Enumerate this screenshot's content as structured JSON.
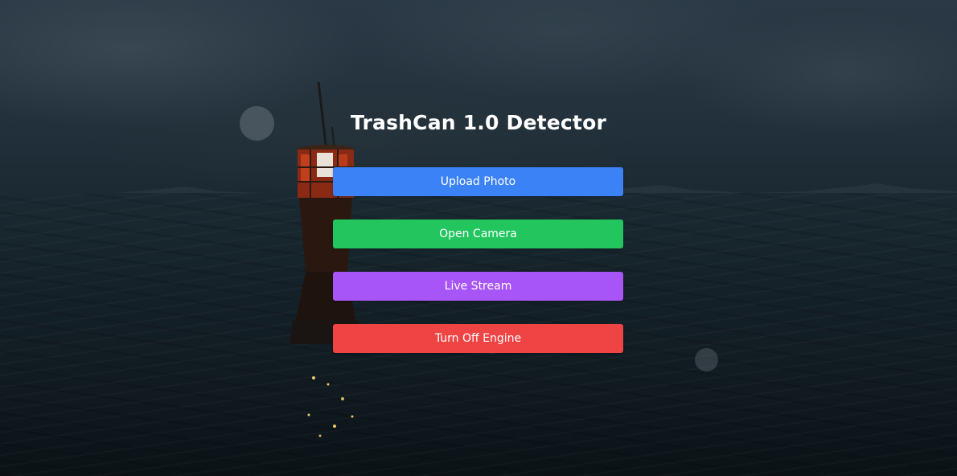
{
  "app": {
    "title": "TrashCan 1.0 Detector"
  },
  "actions": {
    "upload_photo": {
      "label": "Upload Photo",
      "color": "#3b82f6"
    },
    "open_camera": {
      "label": "Open Camera",
      "color": "#22c55e"
    },
    "live_stream": {
      "label": "Live Stream",
      "color": "#a855f7"
    },
    "turn_off_engine": {
      "label": "Turn Off Engine",
      "color": "#ef4444"
    }
  },
  "background": {
    "scene": "stormy-sea-with-buoy"
  }
}
